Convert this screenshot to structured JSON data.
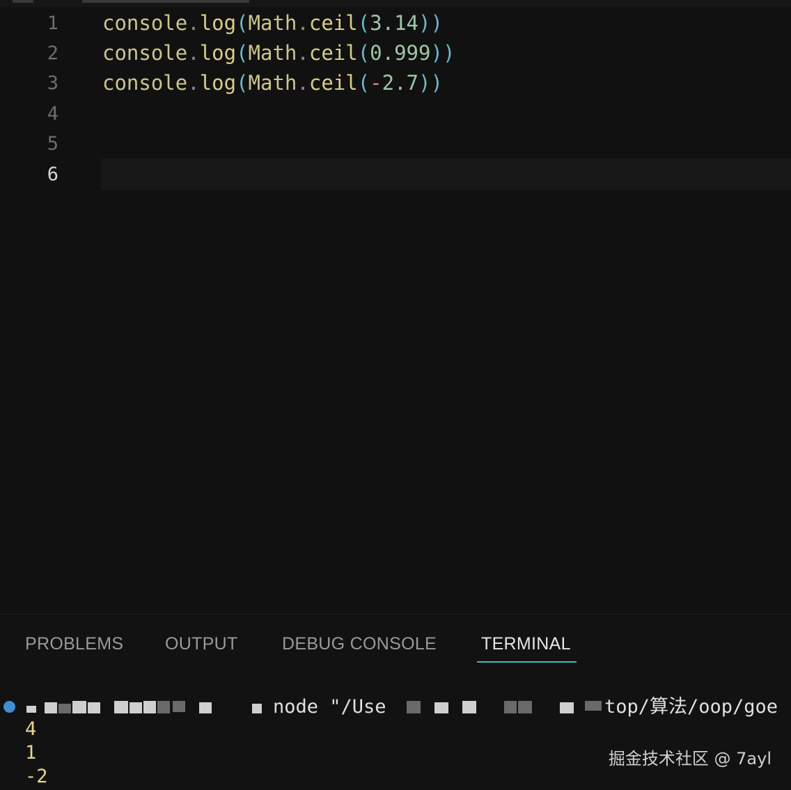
{
  "editor": {
    "lines": [
      {
        "num": "1",
        "tokens": [
          "console",
          ".",
          "log",
          "(",
          "Math",
          ".",
          "ceil",
          "(",
          "3.14",
          ")",
          ")"
        ]
      },
      {
        "num": "2",
        "tokens": [
          "console",
          ".",
          "log",
          "(",
          "Math",
          ".",
          "ceil",
          "(",
          "0.999",
          ")",
          ")"
        ]
      },
      {
        "num": "3",
        "tokens": [
          "console",
          ".",
          "log",
          "(",
          "Math",
          ".",
          "ceil",
          "(",
          "-",
          "2.7",
          ")",
          ")"
        ]
      },
      {
        "num": "4"
      },
      {
        "num": "5"
      },
      {
        "num": "6"
      }
    ]
  },
  "panel": {
    "tabs": [
      "PROBLEMS",
      "OUTPUT",
      "DEBUG CONSOLE",
      "TERMINAL"
    ],
    "active_tab": "TERMINAL",
    "terminal": {
      "command_visible": "node \"/Use",
      "path_tail": "top/算法/oop/goe",
      "output": [
        "4",
        "1",
        "-2"
      ]
    }
  },
  "watermark": "掘金技术社区 @ 7ayl",
  "colors": {
    "background": "#111111",
    "accent_underline": "#4fb7b0",
    "terminal_dot": "#3f8fd4",
    "output_text": "#e8d48e"
  }
}
